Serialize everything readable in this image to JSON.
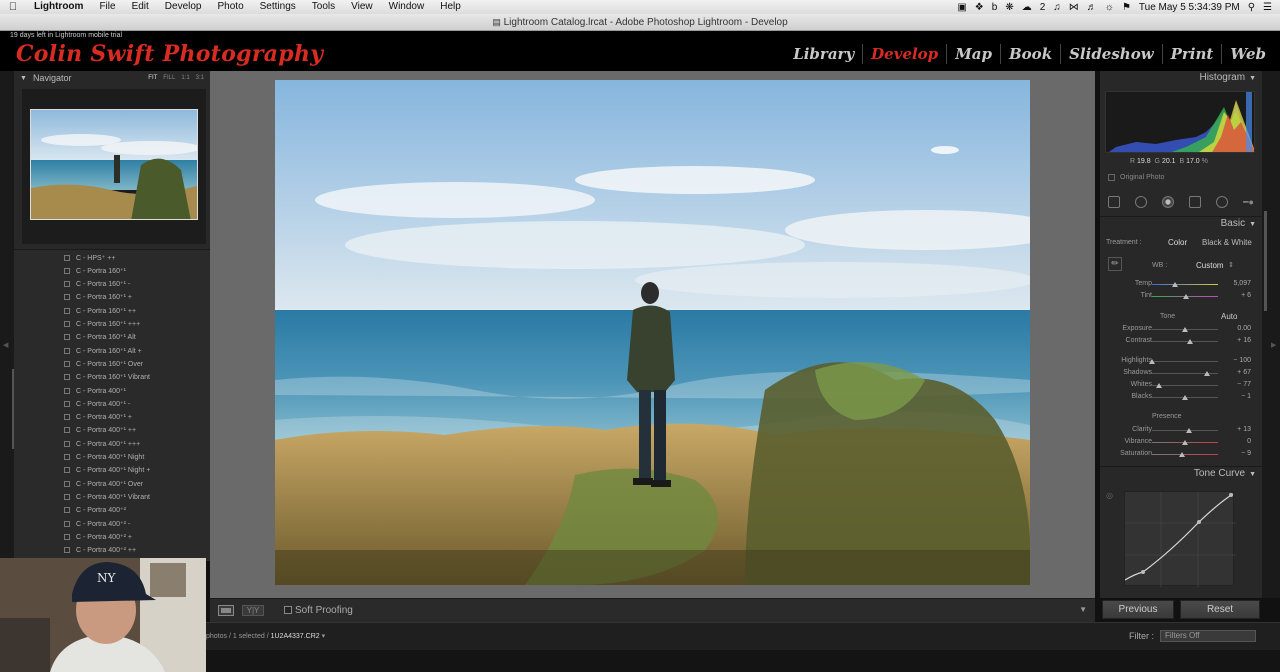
{
  "menubar": {
    "app_name": "Lightroom",
    "items": [
      "File",
      "Edit",
      "Develop",
      "Photo",
      "Settings",
      "Tools",
      "View",
      "Window",
      "Help"
    ],
    "battery": "2",
    "datetime": "Tue May 5  5:34:39 PM"
  },
  "window": {
    "title": "Lightroom Catalog.lrcat - Adobe Photoshop Lightroom - Develop"
  },
  "identity": {
    "trial_notice": "19 days left in Lightroom mobile trial",
    "plate": "Colin Swift Photography"
  },
  "modules": {
    "items": [
      "Library",
      "Develop",
      "Map",
      "Book",
      "Slideshow",
      "Print",
      "Web"
    ],
    "active": "Develop",
    "active_color": "#d82b22"
  },
  "navigator": {
    "title": "Navigator",
    "zoom_options": [
      "FIT",
      "FILL",
      "1:1",
      "3:1"
    ]
  },
  "presets": [
    "C - HPS⁺ ++",
    "C - Portra 160⁺¹",
    "C - Portra 160⁺¹ -",
    "C - Portra 160⁺¹ +",
    "C - Portra 160⁺¹ ++",
    "C - Portra 160⁺¹ +++",
    "C - Portra 160⁺¹ Alt",
    "C - Portra 160⁺¹ Alt +",
    "C - Portra 160⁺¹ Over",
    "C - Portra 160⁺¹ Vibrant",
    "C - Portra 400⁺¹",
    "C - Portra 400⁺¹ -",
    "C - Portra 400⁺¹ +",
    "C - Portra 400⁺¹ ++",
    "C - Portra 400⁺¹ +++",
    "C - Portra 400⁺¹ Night",
    "C - Portra 400⁺¹ Night +",
    "C - Portra 400⁺¹ Over",
    "C - Portra 400⁺¹ Vibrant",
    "C - Portra 400⁺²",
    "C - Portra 400⁺² -",
    "C - Portra 400⁺² +",
    "C - Portra 400⁺² ++"
  ],
  "toolbar": {
    "soft_proofing": "Soft Proofing",
    "yy_label": "Y|Y"
  },
  "histogram": {
    "title": "Histogram",
    "r_label": "R",
    "r_value": "19.8",
    "g_label": "G",
    "g_value": "20.1",
    "b_label": "B",
    "b_value": "17.0",
    "percent": "%",
    "original_photo": "Original Photo"
  },
  "basic": {
    "title": "Basic",
    "treatment_label": "Treatment :",
    "treatment_color": "Color",
    "treatment_bw": "Black & White",
    "wb_label": "WB :",
    "wb_value": "Custom",
    "tone_label": "Tone",
    "auto_label": "Auto",
    "presence_label": "Presence",
    "sliders": [
      {
        "label": "Temp",
        "value": "5,097",
        "pos": 0.35
      },
      {
        "label": "Tint",
        "value": "+ 6",
        "pos": 0.52
      },
      {
        "label": "Exposure",
        "value": "0.00",
        "pos": 0.5
      },
      {
        "label": "Contrast",
        "value": "+ 16",
        "pos": 0.58
      },
      {
        "label": "Highlights",
        "value": "− 100",
        "pos": 0.0
      },
      {
        "label": "Shadows",
        "value": "+ 67",
        "pos": 0.83
      },
      {
        "label": "Whites",
        "value": "− 77",
        "pos": 0.11
      },
      {
        "label": "Blacks",
        "value": "− 1",
        "pos": 0.5
      },
      {
        "label": "Clarity",
        "value": "+ 13",
        "pos": 0.56
      },
      {
        "label": "Vibrance",
        "value": "0",
        "pos": 0.5
      },
      {
        "label": "Saturation",
        "value": "− 9",
        "pos": 0.45
      }
    ]
  },
  "tone_curve": {
    "title": "Tone Curve"
  },
  "buttons": {
    "previous": "Previous",
    "reset": "Reset"
  },
  "filmstrip": {
    "info_prefix": "photos / 1 selected /",
    "filename": "1U2A4337.CR2",
    "filter_label": "Filter :",
    "filter_value": "Filters Off"
  }
}
